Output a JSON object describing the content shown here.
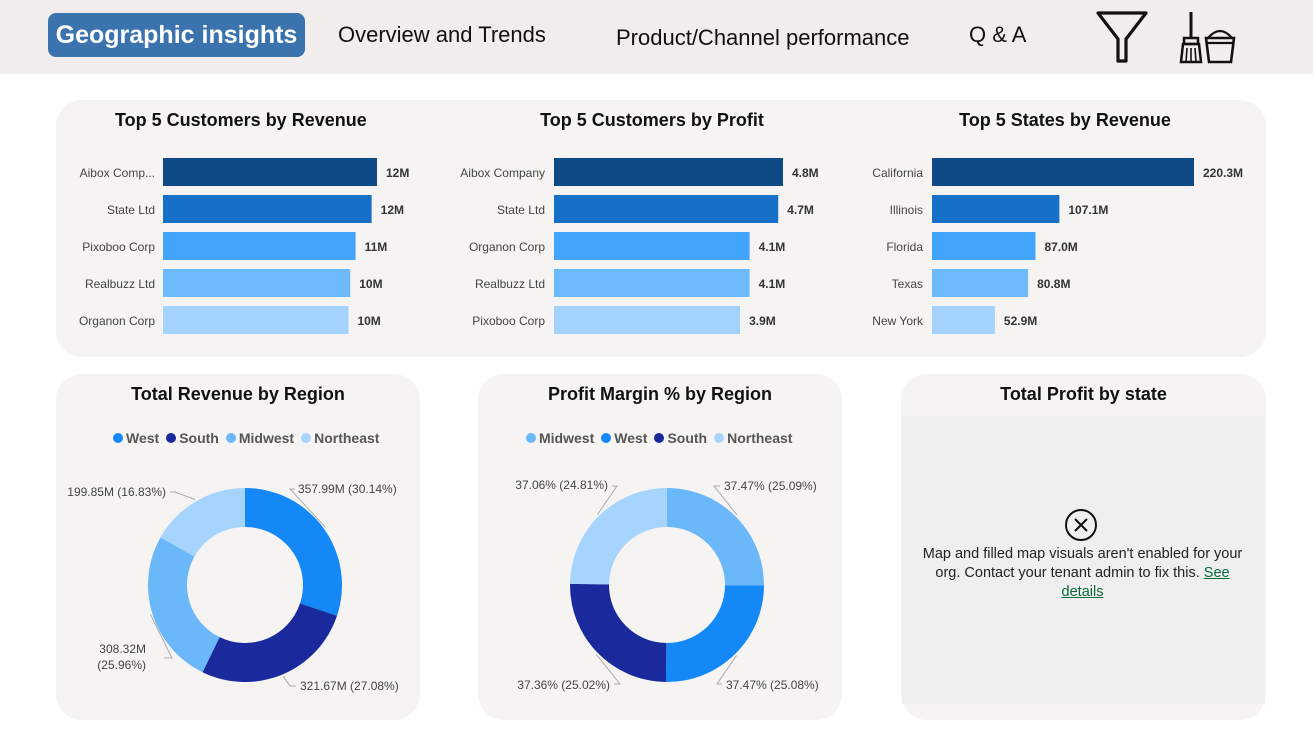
{
  "nav": {
    "active": "Geographic insights",
    "overview": "Overview and Trends",
    "product": "Product/Channel performance",
    "qa": "Q & A",
    "filter_icon": "filter-funnel-icon",
    "clear_icon": "broom-bucket-icon"
  },
  "colors": {
    "rank1": "#0d4a86",
    "rank2": "#1670c8",
    "rank3": "#42a5fb",
    "rank4": "#6cb9fc",
    "rank5": "#a3d3fd",
    "west": "#1588f7",
    "south": "#1a2a9c",
    "midwest": "#6ab8fa",
    "northeast": "#a6d4fd"
  },
  "chart_data": [
    {
      "type": "bar",
      "orientation": "horizontal",
      "title": "Top 5 Customers by Revenue",
      "categories": [
        "Aibox Comp...",
        "State Ltd",
        "Pixoboo Corp",
        "Realbuzz Ltd",
        "Organon Corp"
      ],
      "values": [
        12.0,
        11.7,
        10.8,
        10.5,
        10.4
      ],
      "value_labels": [
        "12M",
        "12M",
        "11M",
        "10M",
        "10M"
      ],
      "xlim": [
        0,
        12.0
      ]
    },
    {
      "type": "bar",
      "orientation": "horizontal",
      "title": "Top 5 Customers by Profit",
      "categories": [
        "Aibox Company",
        "State Ltd",
        "Organon Corp",
        "Realbuzz Ltd",
        "Pixoboo Corp"
      ],
      "values": [
        4.8,
        4.7,
        4.1,
        4.1,
        3.9
      ],
      "value_labels": [
        "4.8M",
        "4.7M",
        "4.1M",
        "4.1M",
        "3.9M"
      ],
      "xlim": [
        0,
        4.8
      ]
    },
    {
      "type": "bar",
      "orientation": "horizontal",
      "title": "Top 5 States by Revenue",
      "categories": [
        "California",
        "Illinois",
        "Florida",
        "Texas",
        "New York"
      ],
      "values": [
        220.3,
        107.1,
        87.0,
        80.8,
        52.9
      ],
      "value_labels": [
        "220.3M",
        "107.1M",
        "87.0M",
        "80.8M",
        "52.9M"
      ],
      "xlim": [
        0,
        220.3
      ]
    },
    {
      "type": "pie",
      "donut": true,
      "title": "Total Revenue by Region",
      "legend": [
        "West",
        "South",
        "Midwest",
        "Northeast"
      ],
      "slices": [
        {
          "name": "West",
          "value": 357.99,
          "label": "357.99M (30.14%)"
        },
        {
          "name": "South",
          "value": 321.67,
          "label": "321.67M (27.08%)"
        },
        {
          "name": "Midwest",
          "value": 308.32,
          "label": "308.32M (25.96%)"
        },
        {
          "name": "Northeast",
          "value": 199.85,
          "label": "199.85M (16.83%)"
        }
      ]
    },
    {
      "type": "pie",
      "donut": true,
      "title": "Profit Margin % by Region",
      "legend": [
        "Midwest",
        "West",
        "South",
        "Northeast"
      ],
      "slices": [
        {
          "name": "Midwest",
          "value": 37.47,
          "label": "37.47% (25.09%)"
        },
        {
          "name": "West",
          "value": 37.47,
          "label": "37.47% (25.08%)"
        },
        {
          "name": "South",
          "value": 37.36,
          "label": "37.36% (25.02%)"
        },
        {
          "name": "Northeast",
          "value": 37.06,
          "label": "37.06% (24.81%)"
        }
      ]
    }
  ],
  "map": {
    "title": "Total Profit by state",
    "message": "Map and filled map visuals aren't enabled for your org. Contact your tenant admin to fix this.",
    "link": "See details",
    "icon": "error-circle-x-icon"
  }
}
